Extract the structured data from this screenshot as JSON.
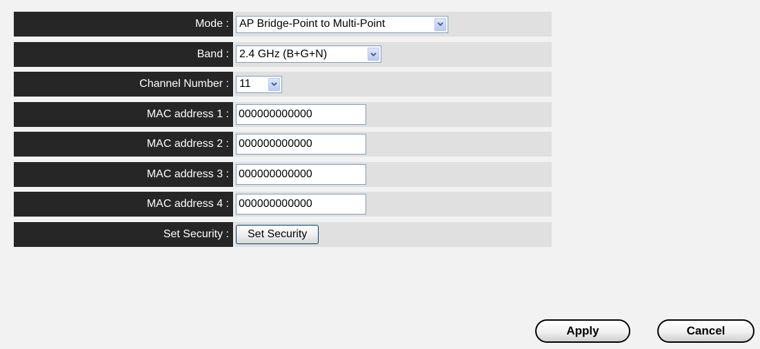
{
  "form": {
    "mode": {
      "label": "Mode :",
      "value": "AP Bridge-Point to Multi-Point"
    },
    "band": {
      "label": "Band :",
      "value": "2.4 GHz (B+G+N)"
    },
    "channel": {
      "label": "Channel Number :",
      "value": "11"
    },
    "mac1": {
      "label": "MAC address 1 :",
      "value": "000000000000"
    },
    "mac2": {
      "label": "MAC address 2 :",
      "value": "000000000000"
    },
    "mac3": {
      "label": "MAC address 3 :",
      "value": "000000000000"
    },
    "mac4": {
      "label": "MAC address 4 :",
      "value": "000000000000"
    },
    "security": {
      "label": "Set Security :",
      "button": "Set Security"
    }
  },
  "actions": {
    "apply": "Apply",
    "cancel": "Cancel"
  },
  "icons": {
    "dropdown": "chevron-down-icon"
  },
  "colors": {
    "label_bg": "#262626",
    "value_bg": "#e0e0e0",
    "page_bg": "#f2f2f2",
    "dropdown_arrow": "#4d6185"
  }
}
